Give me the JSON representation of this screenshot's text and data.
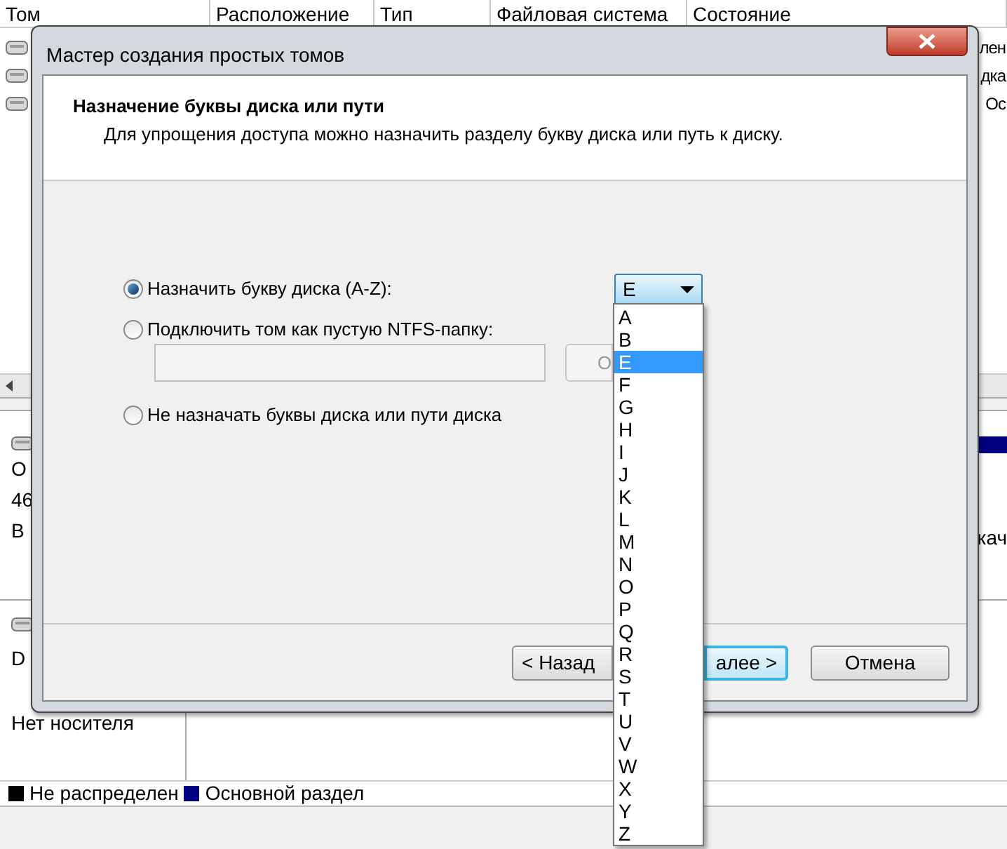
{
  "background_window": {
    "columns": [
      "Том",
      "Расположение",
      "Тип",
      "Файловая система",
      "Состояние"
    ],
    "list_fragments": [
      "лен",
      "дка",
      "Ос"
    ],
    "disk_1": {
      "lines": [
        "О",
        "46",
        "В"
      ],
      "right_fragment": "кач"
    },
    "disk_2": {
      "lines": [
        "D",
        "Нет носителя"
      ]
    },
    "legend": [
      {
        "label": "Не распределен",
        "color": "#000000"
      },
      {
        "label": "Основной раздел",
        "color": "#000080"
      }
    ]
  },
  "dialog": {
    "title": "Мастер создания простых томов",
    "heading": "Назначение буквы диска или пути",
    "subheading": "Для упрощения доступа можно назначить разделу букву диска или путь к диску.",
    "options": [
      {
        "label": "Назначить букву диска (A-Z):",
        "selected": true
      },
      {
        "label": "Подключить том как пустую NTFS-папку:",
        "selected": false
      },
      {
        "label": "Не назначать буквы диска или пути диска",
        "selected": false
      }
    ],
    "drive_letter": {
      "value": "E",
      "expanded": true,
      "options": [
        {
          "label": "A",
          "selected": false
        },
        {
          "label": "B",
          "selected": false
        },
        {
          "label": "E",
          "selected": true
        },
        {
          "label": "F",
          "selected": false
        },
        {
          "label": "G",
          "selected": false
        },
        {
          "label": "H",
          "selected": false
        },
        {
          "label": "I",
          "selected": false
        },
        {
          "label": "J",
          "selected": false
        },
        {
          "label": "K",
          "selected": false
        },
        {
          "label": "L",
          "selected": false
        },
        {
          "label": "M",
          "selected": false
        },
        {
          "label": "N",
          "selected": false
        },
        {
          "label": "O",
          "selected": false
        },
        {
          "label": "P",
          "selected": false
        },
        {
          "label": "Q",
          "selected": false
        },
        {
          "label": "R",
          "selected": false
        },
        {
          "label": "S",
          "selected": false
        },
        {
          "label": "T",
          "selected": false
        },
        {
          "label": "U",
          "selected": false
        },
        {
          "label": "V",
          "selected": false
        },
        {
          "label": "W",
          "selected": false
        },
        {
          "label": "X",
          "selected": false
        },
        {
          "label": "Y",
          "selected": false
        },
        {
          "label": "Z",
          "selected": false
        }
      ]
    },
    "browse_button": "О",
    "buttons": [
      {
        "label": "< Назад",
        "default": false
      },
      {
        "label": "алее >",
        "default": true
      },
      {
        "label": "Отмена",
        "default": false
      }
    ]
  }
}
